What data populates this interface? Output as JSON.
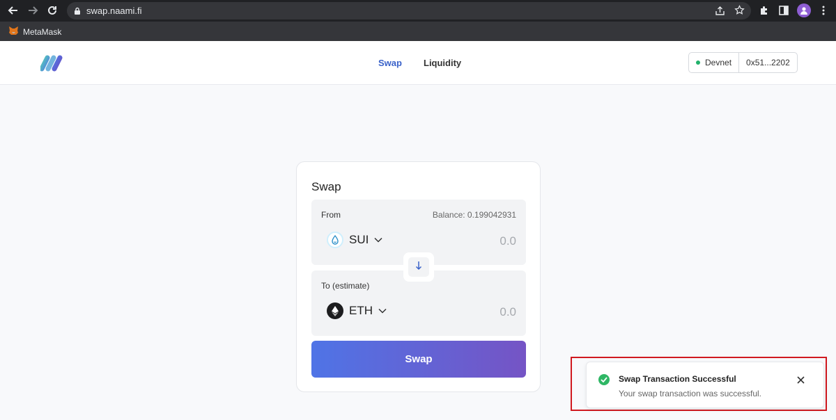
{
  "browser": {
    "url": "swap.naami.fi",
    "bookmark_label": "MetaMask",
    "icons": [
      "back-icon",
      "forward-icon",
      "reload-icon",
      "lock-icon",
      "share-icon",
      "star-icon",
      "extensions-icon",
      "side-panel-icon",
      "profile-icon",
      "menu-icon"
    ]
  },
  "header": {
    "nav": {
      "swap": "Swap",
      "liquidity": "Liquidity"
    },
    "network": "Devnet",
    "address": "0x51...2202",
    "colors": {
      "active_nav": "#3a62c9",
      "network_dot": "#22b16b"
    }
  },
  "swap_card": {
    "title": "Swap",
    "from": {
      "label": "From",
      "balance": "Balance: 0.199042931",
      "token": "SUI",
      "amount": "0.0"
    },
    "to": {
      "label": "To (estimate)",
      "token": "ETH",
      "amount": "0.0"
    },
    "button_label": "Swap",
    "colors": {
      "button_start": "#4f74e6",
      "button_end": "#7554c5"
    }
  },
  "toast": {
    "title": "Swap Transaction Successful",
    "message": "Your swap transaction was successful.",
    "colors": {
      "success": "#2fb765",
      "highlight": "#d0191f"
    }
  }
}
